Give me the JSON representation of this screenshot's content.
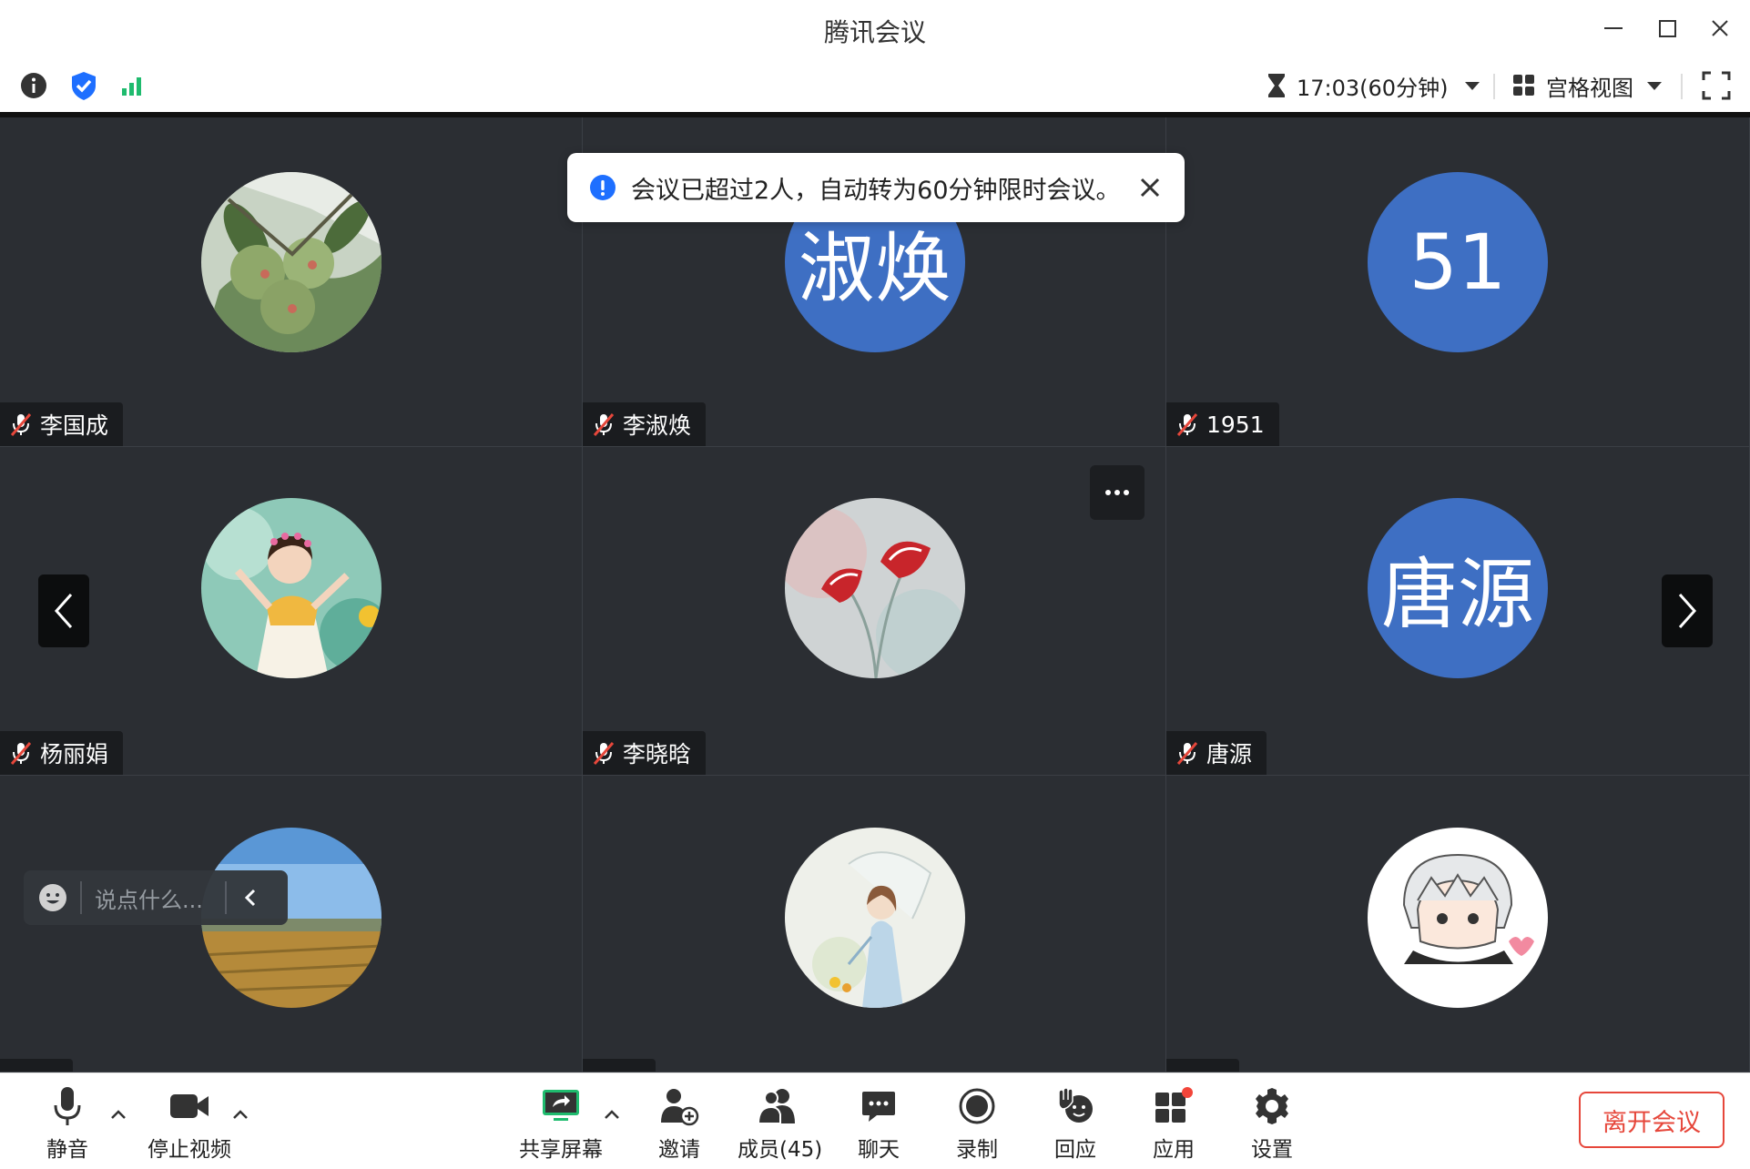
{
  "window": {
    "title": "腾讯会议"
  },
  "infobar": {
    "timer": "17:03(60分钟)",
    "view_mode": "宫格视图"
  },
  "notification": {
    "message": "会议已超过2人，自动转为60分钟限时会议。"
  },
  "participants": [
    {
      "name": "李国成",
      "avatar": "fig-photo"
    },
    {
      "name": "李淑焕",
      "avatar_text": "淑焕"
    },
    {
      "name": "1951",
      "avatar_text": "51"
    },
    {
      "name": "杨丽娟",
      "avatar": "girl-photo"
    },
    {
      "name": "李晓晗",
      "avatar": "flower-photo"
    },
    {
      "name": "唐源",
      "avatar_text": "唐源"
    },
    {
      "name": "",
      "avatar": "field-photo"
    },
    {
      "name": "",
      "avatar": "painting-photo"
    },
    {
      "name": "",
      "avatar": "cartoon-photo"
    }
  ],
  "chat": {
    "placeholder": "说点什么..."
  },
  "toolbar": {
    "mute": "静音",
    "stop_video": "停止视频",
    "share_screen": "共享屏幕",
    "invite": "邀请",
    "members": "成员(45)",
    "chat": "聊天",
    "record": "录制",
    "react": "回应",
    "apps": "应用",
    "settings": "设置",
    "leave": "离开会议"
  },
  "colors": {
    "accent_blue": "#1e6fff",
    "avatar_blue": "#3e6fc3",
    "leave_red": "#e6473b",
    "tile_bg": "#2b2e33",
    "signal_green": "#1fbb6e"
  }
}
